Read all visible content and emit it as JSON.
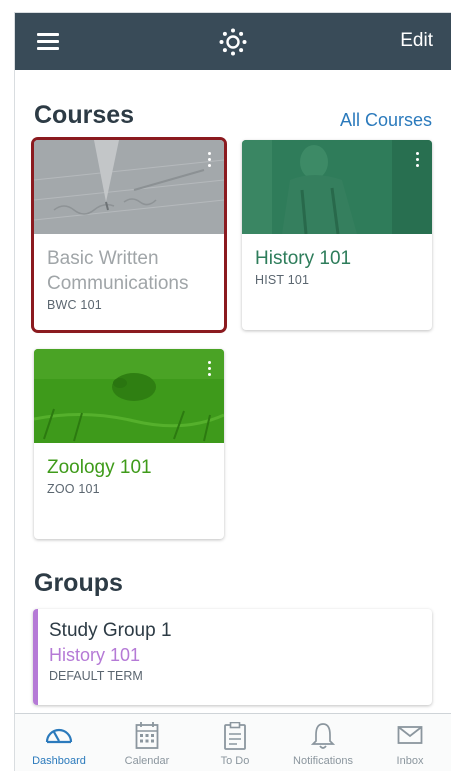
{
  "header": {
    "edit_label": "Edit"
  },
  "courses_section": {
    "title": "Courses",
    "all_courses_label": "All Courses",
    "cards": [
      {
        "name": "Basic Written Communications",
        "code": "BWC 101",
        "color": "#a0a5a8",
        "selected": true
      },
      {
        "name": "History 101",
        "code": "HIST 101",
        "color": "#2e7d5b",
        "selected": false
      },
      {
        "name": "Zoology 101",
        "code": "ZOO 101",
        "color": "#3f9b1a",
        "selected": false
      }
    ]
  },
  "groups_section": {
    "title": "Groups",
    "groups": [
      {
        "name": "Study Group 1",
        "course": "History 101",
        "term": "DEFAULT TERM",
        "color": "#b57ad6"
      }
    ]
  },
  "tabbar": {
    "tabs": [
      {
        "label": "Dashboard",
        "icon": "dashboard-icon",
        "active": true
      },
      {
        "label": "Calendar",
        "icon": "calendar-icon",
        "active": false
      },
      {
        "label": "To Do",
        "icon": "clipboard-icon",
        "active": false
      },
      {
        "label": "Notifications",
        "icon": "bell-icon",
        "active": false
      },
      {
        "label": "Inbox",
        "icon": "envelope-icon",
        "active": false
      }
    ]
  },
  "colors": {
    "navbar": "#394b58",
    "link": "#2b7abc",
    "selected_border": "#8b1a1f"
  }
}
